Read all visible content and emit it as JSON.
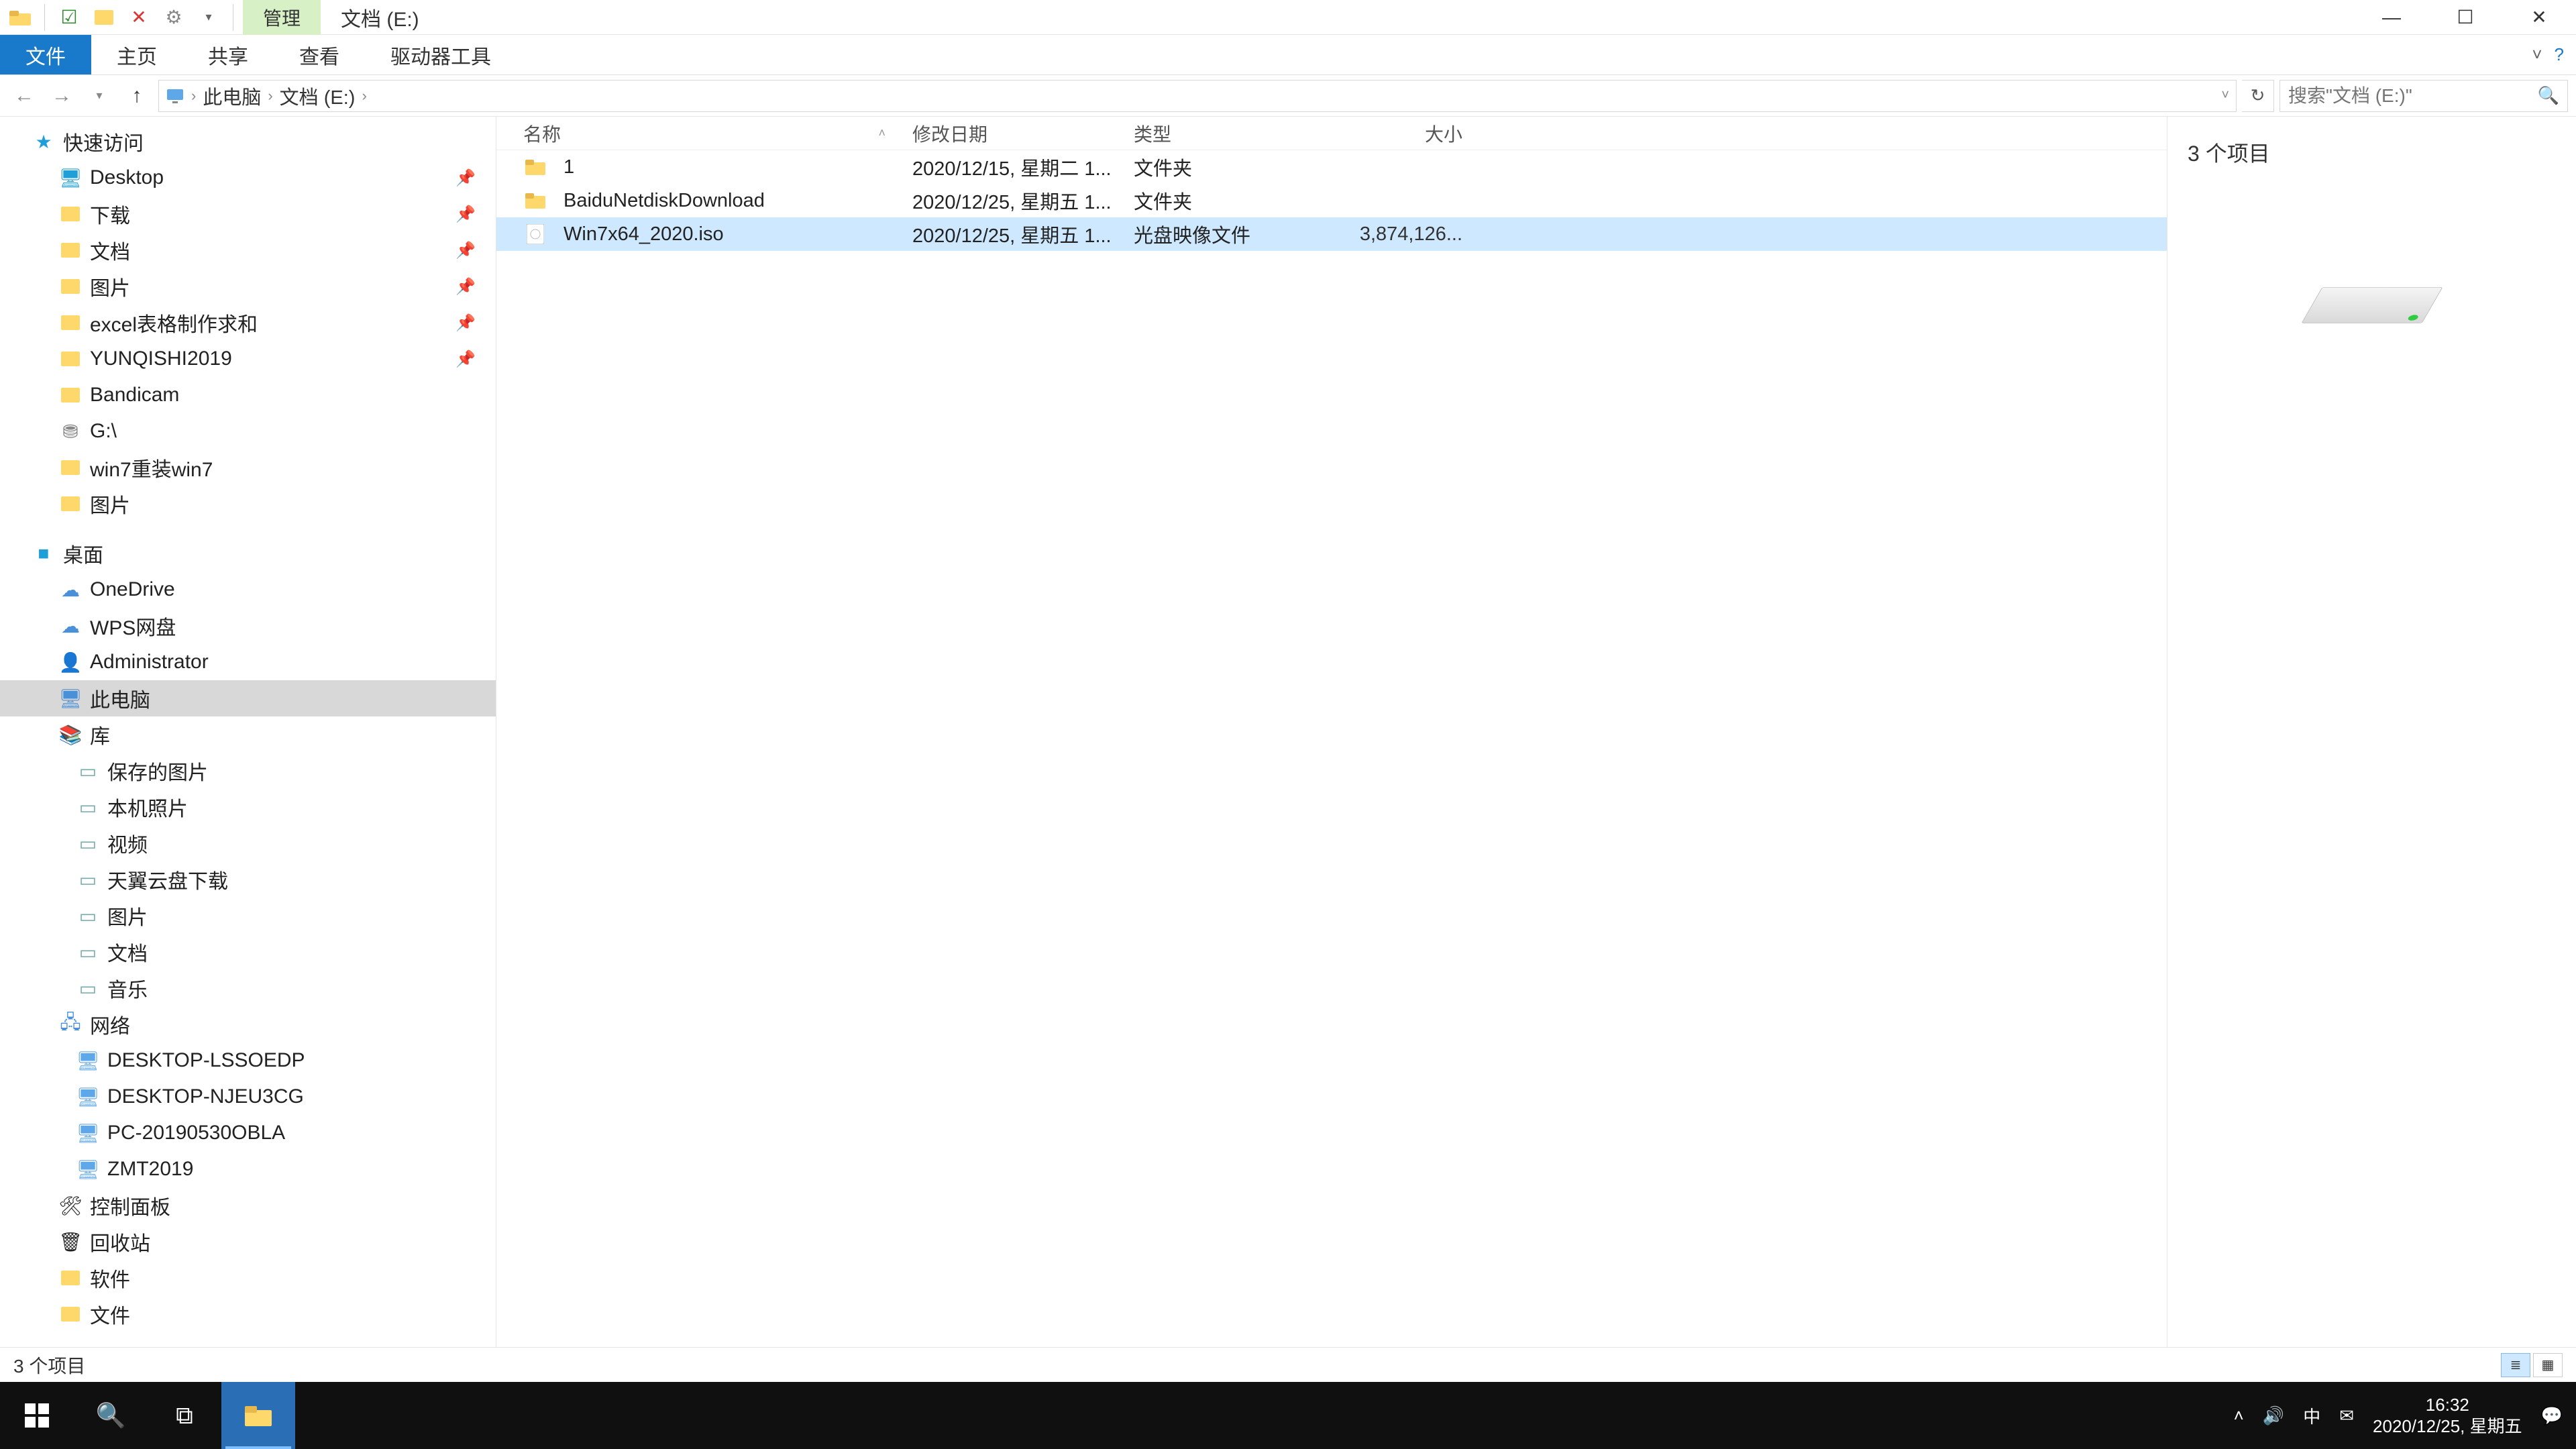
{
  "titlebar": {
    "context_tab": "管理",
    "window_title": "文档 (E:)"
  },
  "ribbon": {
    "file": "文件",
    "home": "主页",
    "share": "共享",
    "view": "查看",
    "drive_tools": "驱动器工具"
  },
  "breadcrumb": {
    "root": "此电脑",
    "drive": "文档 (E:)",
    "dropdown_hint": "v",
    "refresh": "↻"
  },
  "search": {
    "placeholder": "搜索\"文档 (E:)\""
  },
  "nav": {
    "quick_access": "快速访问",
    "quick_items": [
      {
        "icon": "ic-desktop",
        "label": "Desktop",
        "pinned": true
      },
      {
        "icon": "ic-folder",
        "label": "下载",
        "pinned": true
      },
      {
        "icon": "ic-folder",
        "label": "文档",
        "pinned": true
      },
      {
        "icon": "ic-folder",
        "label": "图片",
        "pinned": true
      },
      {
        "icon": "ic-folder",
        "label": "excel表格制作求和",
        "pinned": true
      },
      {
        "icon": "ic-folder",
        "label": "YUNQISHI2019",
        "pinned": true
      },
      {
        "icon": "ic-folder",
        "label": "Bandicam",
        "pinned": false
      },
      {
        "icon": "ic-drive",
        "label": "G:\\",
        "pinned": false
      },
      {
        "icon": "ic-folder",
        "label": "win7重装win7",
        "pinned": false
      },
      {
        "icon": "ic-folder",
        "label": "图片",
        "pinned": false
      }
    ],
    "desktop": "桌面",
    "desktop_items": [
      {
        "icon": "ic-cloud",
        "label": "OneDrive"
      },
      {
        "icon": "ic-cloud",
        "label": "WPS网盘"
      },
      {
        "icon": "ic-user",
        "label": "Administrator"
      },
      {
        "icon": "ic-pc",
        "label": "此电脑",
        "selected": true
      },
      {
        "icon": "ic-lib",
        "label": "库"
      }
    ],
    "lib_items": [
      {
        "label": "保存的图片"
      },
      {
        "label": "本机照片"
      },
      {
        "label": "视频"
      },
      {
        "label": "天翼云盘下载"
      },
      {
        "label": "图片"
      },
      {
        "label": "文档"
      },
      {
        "label": "音乐"
      }
    ],
    "network": "网络",
    "network_items": [
      {
        "label": "DESKTOP-LSSOEDP"
      },
      {
        "label": "DESKTOP-NJEU3CG"
      },
      {
        "label": "PC-20190530OBLA"
      },
      {
        "label": "ZMT2019"
      }
    ],
    "control_panel": "控制面板",
    "recycle_bin": "回收站",
    "software": "软件",
    "docs": "文件"
  },
  "columns": {
    "name": "名称",
    "date": "修改日期",
    "type": "类型",
    "size": "大小"
  },
  "files": [
    {
      "icon": "folder",
      "name": "1",
      "date": "2020/12/15, 星期二 1...",
      "type": "文件夹",
      "size": ""
    },
    {
      "icon": "folder",
      "name": "BaiduNetdiskDownload",
      "date": "2020/12/25, 星期五 1...",
      "type": "文件夹",
      "size": ""
    },
    {
      "icon": "iso",
      "name": "Win7x64_2020.iso",
      "date": "2020/12/25, 星期五 1...",
      "type": "光盘映像文件",
      "size": "3,874,126...",
      "selected": true
    }
  ],
  "preview": {
    "count_label": "3 个项目"
  },
  "status": {
    "text": "3 个项目"
  },
  "taskbar": {
    "time": "16:32",
    "date": "2020/12/25, 星期五",
    "ime": "中"
  }
}
